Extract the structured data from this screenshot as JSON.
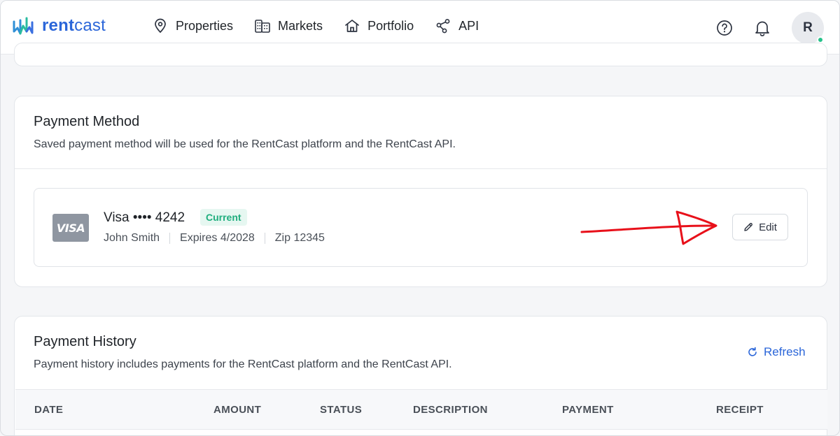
{
  "brand": {
    "name_part1": "rent",
    "name_part2": "cast",
    "color": "#2b66d9"
  },
  "nav": {
    "items": [
      {
        "label": "Properties",
        "icon": "map-pin-icon"
      },
      {
        "label": "Markets",
        "icon": "buildings-icon"
      },
      {
        "label": "Portfolio",
        "icon": "home-icon"
      },
      {
        "label": "API",
        "icon": "share-nodes-icon"
      }
    ]
  },
  "header": {
    "help_icon": "help-circle-icon",
    "notifications_icon": "bell-icon",
    "avatar_initial": "R",
    "status_color": "#25c28a"
  },
  "payment_method": {
    "title": "Payment Method",
    "subtitle": "Saved payment method will be used for the RentCast platform and the RentCast API.",
    "card": {
      "brand_badge": "VISA",
      "name": "Visa •••• 4242",
      "status_badge": "Current",
      "holder": "John Smith",
      "expires": "Expires 4/2028",
      "zip": "Zip 12345"
    },
    "edit_label": "Edit"
  },
  "payment_history": {
    "title": "Payment History",
    "subtitle": "Payment history includes payments for the RentCast platform and the RentCast API.",
    "refresh_label": "Refresh",
    "columns": [
      "DATE",
      "AMOUNT",
      "STATUS",
      "DESCRIPTION",
      "PAYMENT",
      "RECEIPT"
    ]
  },
  "annotation": {
    "color": "#e8101a"
  }
}
